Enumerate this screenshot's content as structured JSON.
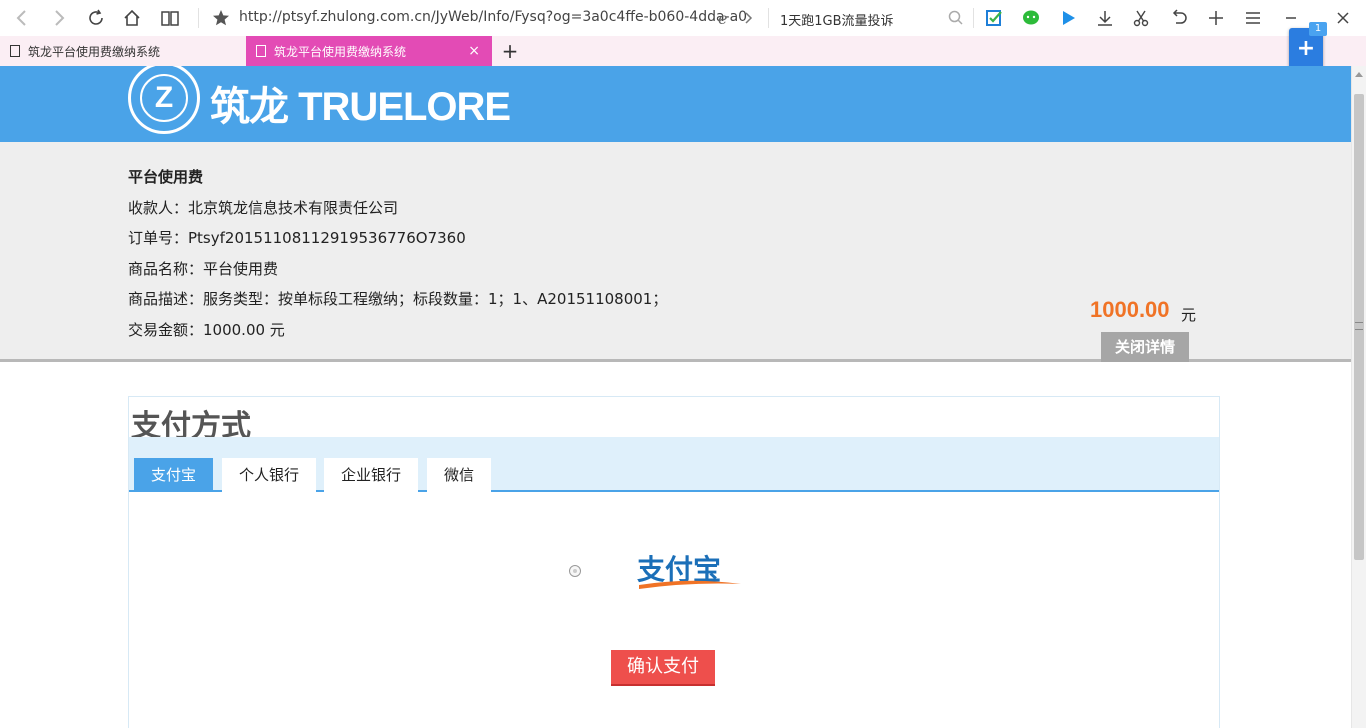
{
  "browser": {
    "url": "http://ptsyf.zhulong.com.cn/JyWeb/Info/Fysq?og=3a0c4ffe-b060-4dda-a0",
    "search_text": "1天跑1GB流量投诉",
    "float_badge": "1",
    "float_plus": "+",
    "new_tab": "+",
    "tabs": [
      {
        "label": "筑龙平台使用费缴纳系统"
      },
      {
        "label": "筑龙平台使用费缴纳系统",
        "close": "×"
      }
    ]
  },
  "header": {
    "logo_mark": "Z",
    "logo_text": "筑龙 TRUELORE"
  },
  "order": {
    "title": "平台使用费",
    "payee": "收款人：北京筑龙信息技术有限责任公司",
    "order_no": "订单号：Ptsyf20151108112919536776O7360",
    "product_name": "商品名称：平台使用费",
    "product_desc": "商品描述：服务类型：按单标段工程缴纳；标段数量：1；1、A20151108001；",
    "trade_amount": "交易金额：1000.00 元",
    "amount": "1000.00",
    "amount_unit": "元",
    "close_detail": "关闭详情"
  },
  "payment": {
    "title": "支付方式",
    "tabs": [
      "支付宝",
      "个人银行",
      "企业银行",
      "微信"
    ],
    "active_tab": 0,
    "alipay_logo_text": "支付宝",
    "confirm": "确认支付"
  },
  "colors": {
    "header_blue": "#4aa3e8",
    "amount_orange": "#f07326",
    "confirm_red": "#ee4f4c",
    "tab_pink": "#e34bb5"
  }
}
